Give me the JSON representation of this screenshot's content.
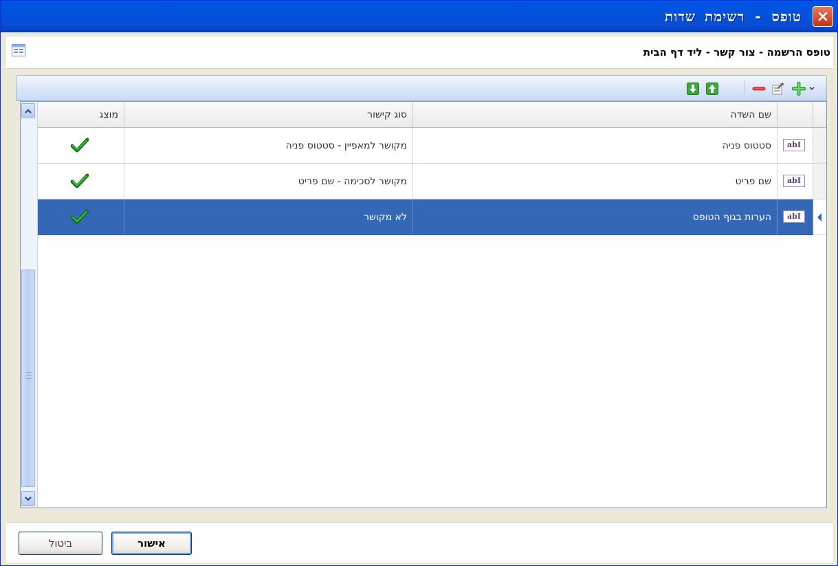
{
  "window": {
    "title": "טופס - רשימת שדות",
    "form_title": "טופס הרשמה - צור קשר - ליד דף הבית"
  },
  "toolbar": {
    "buttons": [
      "add-dropdown",
      "add",
      "edit",
      "remove",
      "move-up",
      "move-down"
    ]
  },
  "grid": {
    "columns": {
      "field_name": "שם השדה",
      "link_type": "סוג קישור",
      "displayed": "מוצג"
    },
    "rows": [
      {
        "field_name": "סטטוס פניה",
        "link_type": "מקושר למאפיין - סטטוס פניה",
        "displayed": true,
        "type_icon": "abI"
      },
      {
        "field_name": "שם פריט",
        "link_type": "מקושר לסכימה - שם פריט",
        "displayed": true,
        "type_icon": "abI"
      },
      {
        "field_name": "הערות בגוף הטופס",
        "link_type": "לא מקושר",
        "displayed": true,
        "type_icon": "abI",
        "selected": true
      }
    ]
  },
  "buttons": {
    "ok": "אישור",
    "cancel": "ביטול"
  },
  "colors": {
    "titlebar": "#0054e3",
    "selection": "#3467b6",
    "check": "#1f8a1f"
  }
}
